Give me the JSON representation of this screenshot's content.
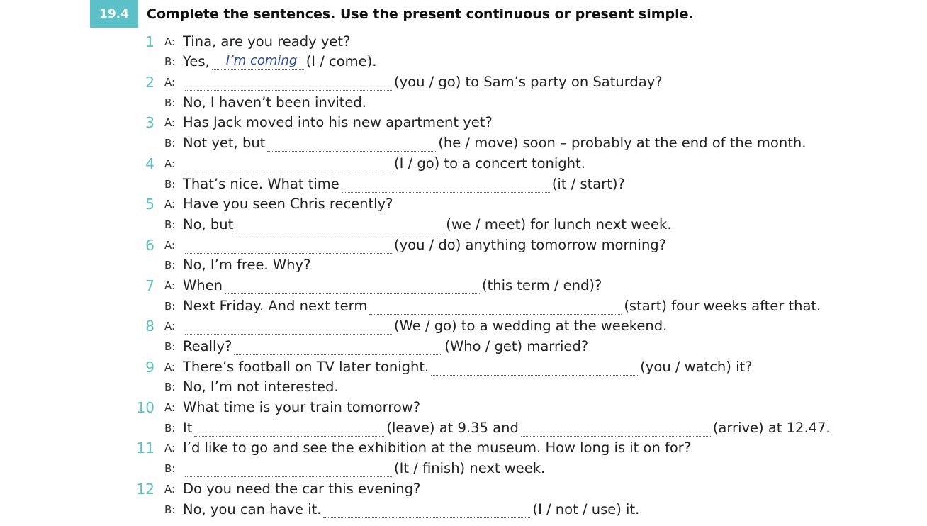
{
  "exercise": {
    "number": "19.4",
    "instruction": "Complete the sentences.  Use the present continuous or present simple."
  },
  "lines": [
    {
      "num": "1",
      "speaker": "A:",
      "parts": [
        {
          "t": "Tina, are you ready yet?"
        }
      ]
    },
    {
      "num": "",
      "speaker": "B:",
      "parts": [
        {
          "t": "Yes, "
        },
        {
          "blank": 130,
          "answer": "I’m coming"
        },
        {
          "t": "(I / come)."
        }
      ]
    },
    {
      "num": "2",
      "speaker": "A:",
      "parts": [
        {
          "blank": 292
        },
        {
          "t": "(you / go) to Sam’s party on Saturday?"
        }
      ]
    },
    {
      "num": "",
      "speaker": "B:",
      "parts": [
        {
          "t": "No, I haven’t been invited."
        }
      ]
    },
    {
      "num": "3",
      "speaker": "A:",
      "parts": [
        {
          "t": "Has Jack moved into his new apartment yet?"
        }
      ]
    },
    {
      "num": "",
      "speaker": "B:",
      "parts": [
        {
          "t": "Not yet, but "
        },
        {
          "blank": 238
        },
        {
          "t": "(he / move) soon – probably at the end of the month."
        }
      ]
    },
    {
      "num": "4",
      "speaker": "A:",
      "parts": [
        {
          "blank": 292
        },
        {
          "t": "(I / go) to a concert tonight."
        }
      ]
    },
    {
      "num": "",
      "speaker": "B:",
      "parts": [
        {
          "t": "That’s nice.  What time "
        },
        {
          "blank": 294
        },
        {
          "t": "(it / start)?"
        }
      ]
    },
    {
      "num": "5",
      "speaker": "A:",
      "parts": [
        {
          "t": "Have you seen Chris recently?"
        }
      ]
    },
    {
      "num": "",
      "speaker": "B:",
      "parts": [
        {
          "t": "No, but "
        },
        {
          "blank": 294
        },
        {
          "t": "(we / meet) for lunch next week."
        }
      ]
    },
    {
      "num": "6",
      "speaker": "A:",
      "parts": [
        {
          "blank": 292
        },
        {
          "t": "(you / do) anything tomorrow morning?"
        }
      ]
    },
    {
      "num": "",
      "speaker": "B:",
      "parts": [
        {
          "t": "No, I’m free.  Why?"
        }
      ]
    },
    {
      "num": "7",
      "speaker": "A:",
      "parts": [
        {
          "t": "When "
        },
        {
          "blank": 360
        },
        {
          "t": "(this term / end)?"
        }
      ]
    },
    {
      "num": "",
      "speaker": "B:",
      "parts": [
        {
          "t": "Next Friday.  And next term "
        },
        {
          "blank": 356
        },
        {
          "t": "(start) four weeks after that."
        }
      ]
    },
    {
      "num": "8",
      "speaker": "A:",
      "parts": [
        {
          "blank": 292
        },
        {
          "t": "(We / go) to a wedding at the weekend."
        }
      ]
    },
    {
      "num": "",
      "speaker": "B:",
      "parts": [
        {
          "t": "Really? "
        },
        {
          "blank": 294
        },
        {
          "t": "(Who / get) married?"
        }
      ]
    },
    {
      "num": "9",
      "speaker": "A:",
      "parts": [
        {
          "t": "There’s football on TV later tonight.  "
        },
        {
          "blank": 292
        },
        {
          "t": "(you / watch) it?"
        }
      ]
    },
    {
      "num": "",
      "speaker": "B:",
      "parts": [
        {
          "t": "No, I’m not interested."
        }
      ]
    },
    {
      "num": "10",
      "speaker": "A:",
      "parts": [
        {
          "t": "What time is your train tomorrow?"
        }
      ]
    },
    {
      "num": "",
      "speaker": "B:",
      "parts": [
        {
          "t": "It "
        },
        {
          "blank": 268
        },
        {
          "t": "(leave) at 9.35 and "
        },
        {
          "blank": 268
        },
        {
          "t": "(arrive) at 12.47."
        }
      ]
    },
    {
      "num": "11",
      "speaker": "A:",
      "parts": [
        {
          "t": "I’d like to go and see the exhibition at the museum.  How long is it on for?"
        }
      ]
    },
    {
      "num": "",
      "speaker": "B:",
      "parts": [
        {
          "blank": 292
        },
        {
          "t": "(It / finish) next week."
        }
      ]
    },
    {
      "num": "12",
      "speaker": "A:",
      "parts": [
        {
          "t": "Do you need the car this evening?"
        }
      ]
    },
    {
      "num": "",
      "speaker": "B:",
      "parts": [
        {
          "t": "No, you can have it.  "
        },
        {
          "blank": 292
        },
        {
          "t": "(I / not / use) it."
        }
      ]
    }
  ]
}
